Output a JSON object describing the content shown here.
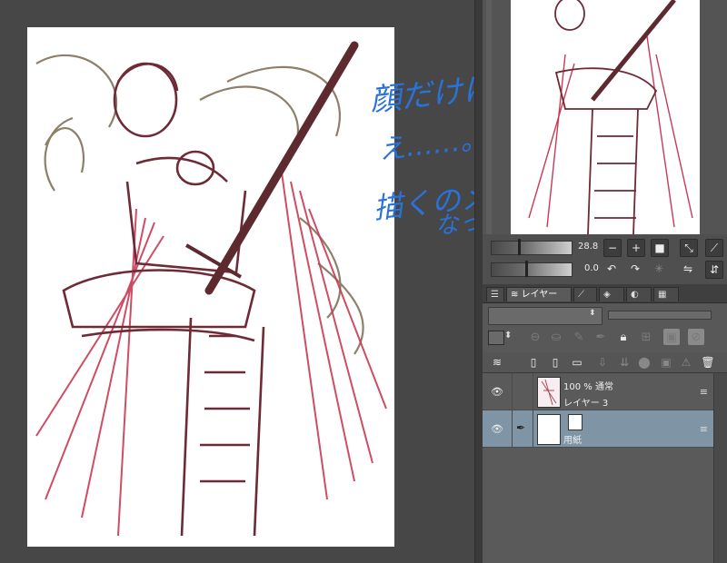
{
  "annotation": {
    "line1": "顔だけにしようかな……。",
    "line2": "え……。",
    "line3": "描くのメンドー……に",
    "line4": "なってきた……。"
  },
  "tool_property": {
    "brush_size": "28.8",
    "opacity": "0.0"
  },
  "tabs": {
    "layer_label": "レイヤー"
  },
  "layers": [
    {
      "blend": "100 % 通常",
      "name": "レイヤー 3",
      "selected": false
    },
    {
      "blend": "",
      "name": "用紙",
      "selected": true
    }
  ],
  "colors": {
    "sketch_dark": "#6e2a35",
    "sketch_red": "#c83a55",
    "sketch_brown": "#7a6a52",
    "annotation_blue": "#2a72d8",
    "selected_layer": "#7f95a6"
  }
}
